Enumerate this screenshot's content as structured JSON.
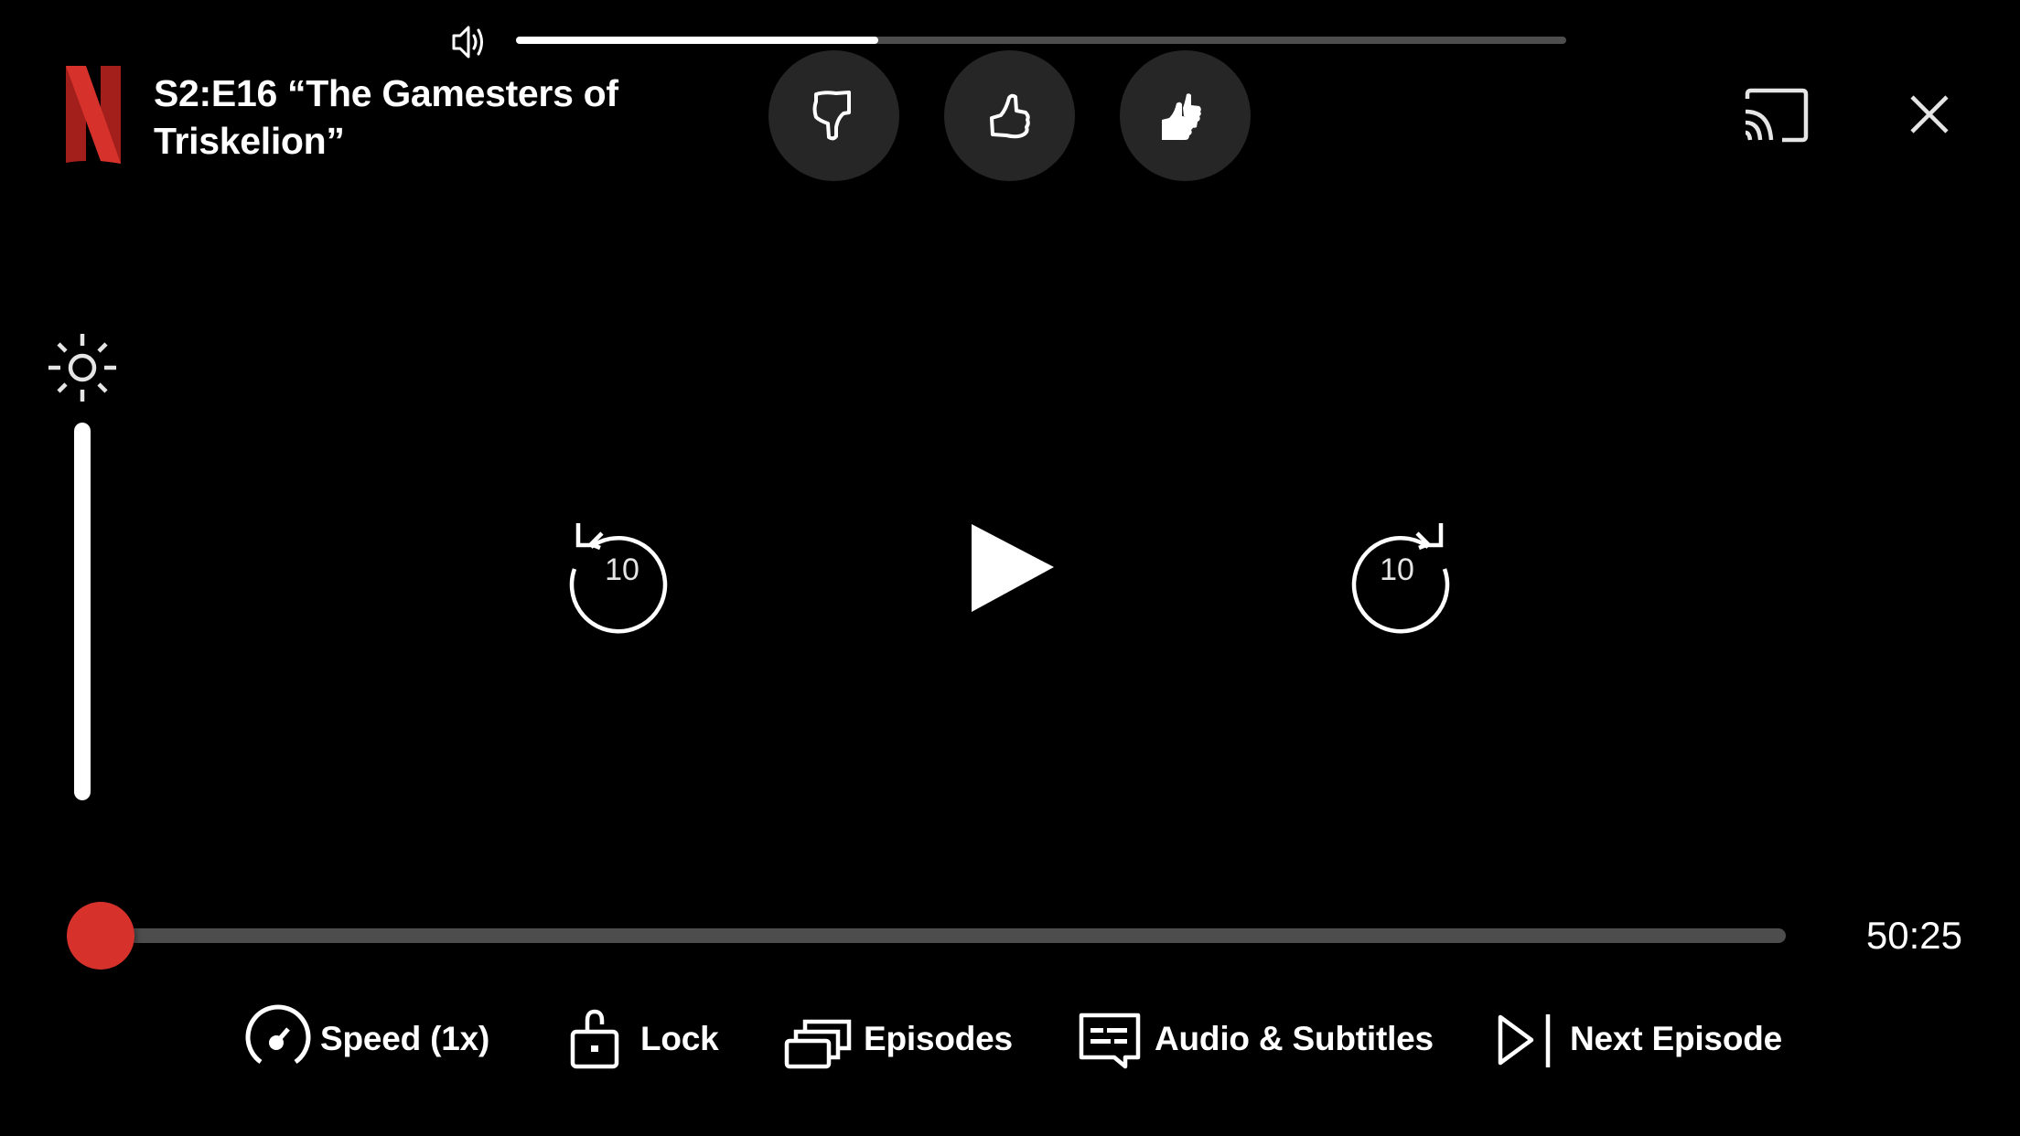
{
  "player": {
    "episode_title": "S2:E16 “The Gamesters of Triskelion”",
    "time_remaining": "50:25",
    "playback_progress_fraction": 0.0,
    "volume_fraction": 0.345,
    "brightness_fraction": 1.0,
    "state": "paused"
  },
  "icons": {
    "logo": "netflix-logo",
    "volume": "speaker-icon",
    "brightness": "sun-icon",
    "cast": "cast-icon",
    "close": "close-icon",
    "rewind": "rewind-10-icon",
    "play": "play-icon",
    "forward": "forward-10-icon"
  },
  "center_controls": {
    "rewind_seconds": "10",
    "forward_seconds": "10"
  },
  "rating": [
    {
      "name": "not-for-me",
      "icon": "thumbs-down-icon"
    },
    {
      "name": "i-like-this",
      "icon": "thumbs-up-icon"
    },
    {
      "name": "love-this",
      "icon": "double-thumbs-up-icon"
    }
  ],
  "bottom_bar": {
    "speed_label": "Speed (1x)",
    "lock_label": "Lock",
    "episodes_label": "Episodes",
    "audio_subtitles_label": "Audio & Subtitles",
    "next_episode_label": "Next Episode"
  },
  "colors": {
    "brand_red": "#d6322b",
    "background": "#000000",
    "button_bg": "#262626",
    "track": "#4d4d4d",
    "foreground": "#ffffff"
  }
}
